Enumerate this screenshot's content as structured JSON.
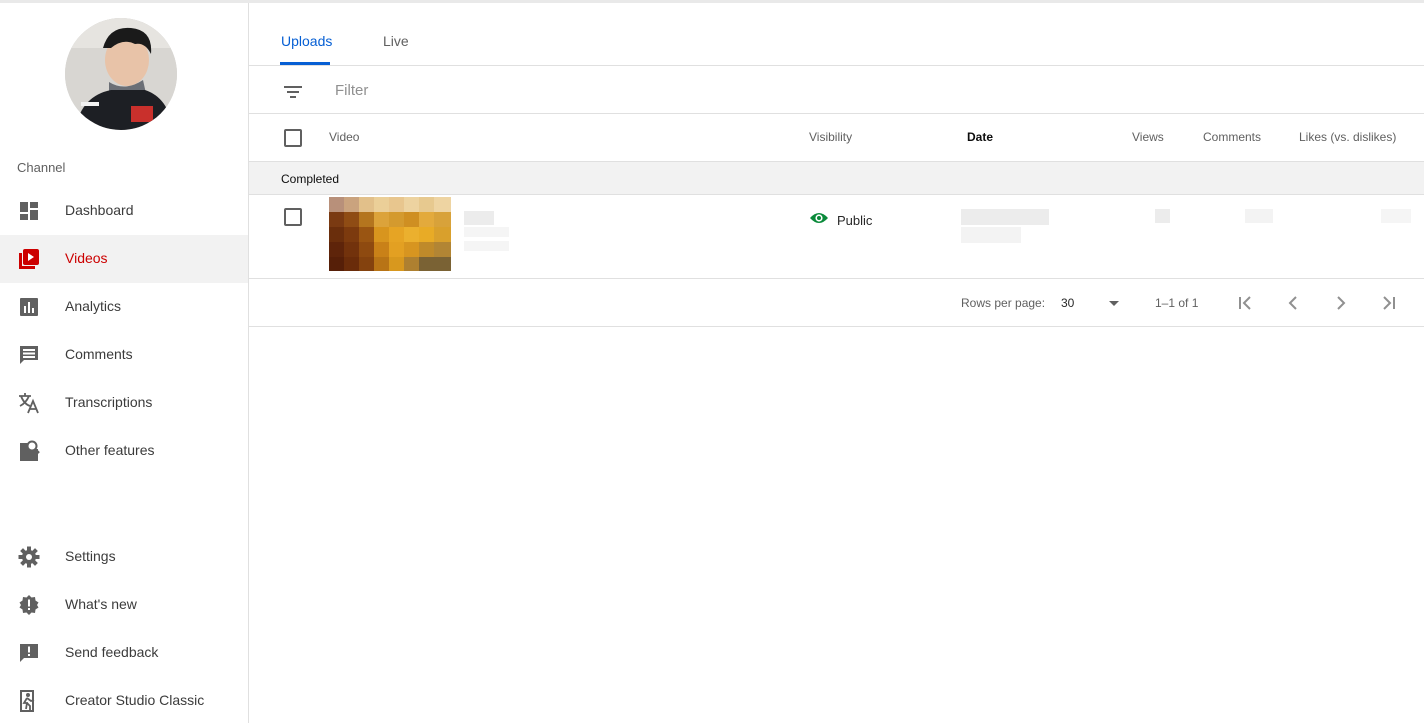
{
  "sidebar": {
    "section_label": "Channel",
    "items": [
      {
        "label": "Dashboard",
        "icon": "dashboard-icon"
      },
      {
        "label": "Videos",
        "icon": "videos-icon"
      },
      {
        "label": "Analytics",
        "icon": "analytics-icon"
      },
      {
        "label": "Comments",
        "icon": "comments-icon"
      },
      {
        "label": "Transcriptions",
        "icon": "translate-icon"
      },
      {
        "label": "Other features",
        "icon": "other-features-icon"
      }
    ],
    "bottom_items": [
      {
        "label": "Settings",
        "icon": "gear-icon"
      },
      {
        "label": "What's new",
        "icon": "whats-new-icon"
      },
      {
        "label": "Send feedback",
        "icon": "feedback-icon"
      },
      {
        "label": "Creator Studio Classic",
        "icon": "classic-exit-icon"
      }
    ],
    "active_item": "Videos"
  },
  "tabs": [
    {
      "label": "Uploads",
      "active": true
    },
    {
      "label": "Live",
      "active": false
    }
  ],
  "filter": {
    "placeholder": "Filter",
    "value": ""
  },
  "table": {
    "columns": [
      "Video",
      "Visibility",
      "Date",
      "Views",
      "Comments",
      "Likes (vs. dislikes)"
    ],
    "sorted_column": "Date",
    "group_label": "Completed",
    "rows": [
      {
        "visibility": "Public",
        "visibility_icon": "eye-icon"
      }
    ]
  },
  "pagination": {
    "rows_per_page_label": "Rows per page:",
    "rows_per_page": "30",
    "range": "1–1 of 1"
  },
  "colors": {
    "accent_blue": "#065fd4",
    "active_red": "#cc0000",
    "public_green": "#0f9d58"
  }
}
